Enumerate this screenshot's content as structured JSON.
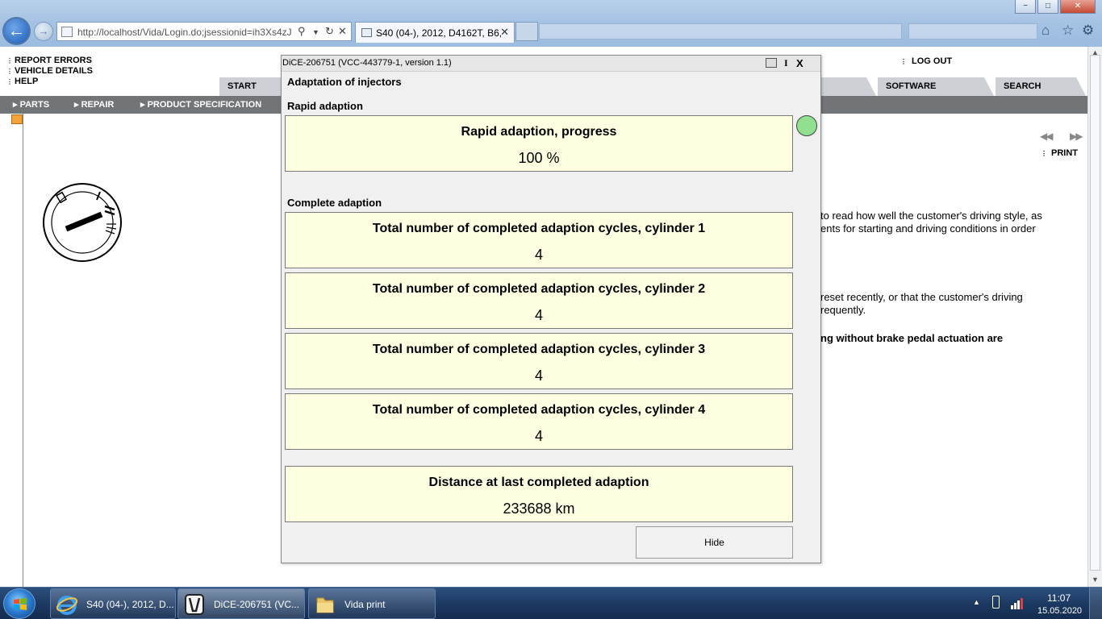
{
  "browser": {
    "address": "http://localhost/Vida/Login.do;jsessionid=ih3Xs4zJ",
    "tab_title": "S40 (04-), 2012, D4162T, B6, ...",
    "window_controls": {
      "minimize": "−",
      "maximize": "□",
      "close": "✕"
    }
  },
  "page": {
    "top_links": [
      "REPORT ERRORS",
      "VEHICLE DETAILS",
      "HELP"
    ],
    "logout": "LOG OUT",
    "tabs": [
      "START",
      "SOFTWARE",
      "SEARCH"
    ],
    "subnav": [
      "PARTS",
      "REPAIR",
      "PRODUCT SPECIFICATION"
    ],
    "print": "PRINT",
    "text_lines": [
      "to read how well the customer's driving style, as",
      "ents for starting and driving conditions in order",
      "reset recently, or that the customer's driving",
      "requently.",
      "ng without brake pedal actuation are"
    ]
  },
  "dialog": {
    "title": "DiCE-206751  (VCC-443779-1, version 1.1)",
    "info_label": "I",
    "close_label": "X",
    "heading": "Adaptation of injectors",
    "rapid_section": "Rapid adaption",
    "rapid_progress": {
      "label": "Rapid adaption, progress",
      "value": "100 %"
    },
    "status_color": "#90e090",
    "complete_section": "Complete adaption",
    "cylinders": [
      {
        "label": "Total number of completed adaption cycles, cylinder 1",
        "value": "4"
      },
      {
        "label": "Total number of completed adaption cycles, cylinder 2",
        "value": "4"
      },
      {
        "label": "Total number of completed adaption cycles, cylinder 3",
        "value": "4"
      },
      {
        "label": "Total number of completed adaption cycles, cylinder 4",
        "value": "4"
      }
    ],
    "distance": {
      "label": "Distance at last completed adaption",
      "value": "233688 km"
    },
    "hide_button": "Hide"
  },
  "taskbar": {
    "items": [
      {
        "label": "S40 (04-), 2012, D...",
        "icon": "internet-explorer-icon"
      },
      {
        "label": "DiCE-206751   (VC...",
        "icon": "volvo-dice-icon"
      },
      {
        "label": "Vida print",
        "icon": "folder-icon"
      }
    ],
    "time": "11:07",
    "date": "15.05.2020"
  }
}
